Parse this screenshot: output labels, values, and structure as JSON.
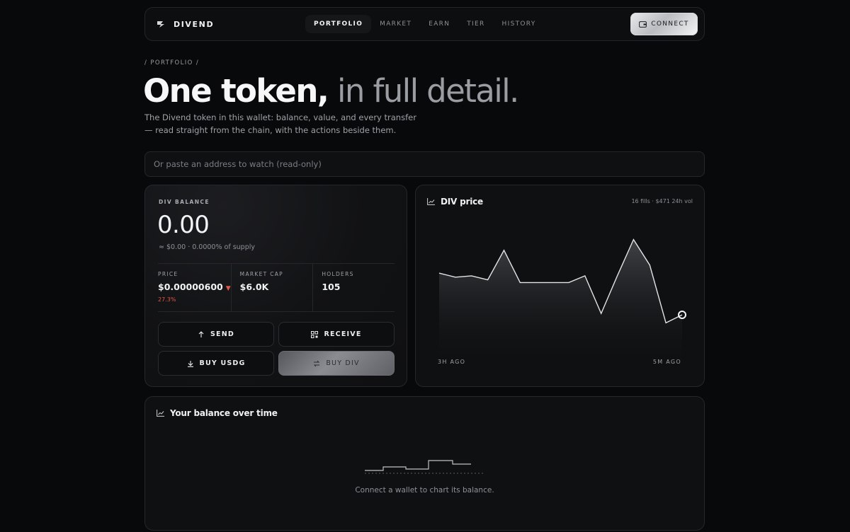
{
  "nav": {
    "brand": "DIVEND",
    "links": [
      "PORTFOLIO",
      "MARKET",
      "EARN",
      "TIER",
      "HISTORY"
    ],
    "active": "PORTFOLIO",
    "connect_label": "CONNECT"
  },
  "hero": {
    "breadcrumb": "/ PORTFOLIO /",
    "title_strong": "One token,",
    "title_light": " in full detail.",
    "description": "The Divend token in this wallet: balance, value, and every transfer — read straight from the chain, with the actions beside them."
  },
  "address": {
    "placeholder": "Or paste an address to watch (read-only)",
    "value": ""
  },
  "balance": {
    "label": "DIV BALANCE",
    "value": "0.00",
    "sub": "≈ $0.00 · 0.0000% of supply",
    "stats": {
      "price_label": "PRICE",
      "price_value": "$0.00000600",
      "price_change": "27.3%",
      "price_direction": "down",
      "cap_label": "MARKET CAP",
      "cap_value": "$6.0K",
      "holders_label": "HOLDERS",
      "holders_value": "105"
    },
    "actions": {
      "send": "SEND",
      "receive": "RECEIVE",
      "buy_usdg": "BUY USDG",
      "buy_div": "BUY DIV"
    }
  },
  "price_chart": {
    "title": "DIV price",
    "meta": "16 fills · $471 24h vol",
    "x_start_label": "3H AGO",
    "x_end_label": "5M AGO"
  },
  "history": {
    "title": "Your balance over time",
    "empty_message": "Connect a wallet to chart its balance."
  },
  "colors": {
    "background": "#08090a",
    "card": "#0f1012",
    "border": "#25272b",
    "negative": "#e0574a"
  },
  "chart_data": {
    "type": "line",
    "title": "DIV price",
    "x": [
      "3H AGO",
      "",
      "",
      "",
      "",
      "",
      "",
      "",
      "",
      "",
      "",
      "",
      "",
      "",
      "",
      "5M AGO"
    ],
    "series": [
      {
        "values": [
          6.1,
          5.8,
          5.9,
          5.6,
          7.8,
          5.4,
          5.4,
          5.4,
          5.4,
          5.9,
          3.1,
          5.9,
          8.6,
          6.7,
          2.4,
          3.0
        ]
      }
    ],
    "ylim": [
      0,
      10
    ],
    "grid": false,
    "legend": "none"
  }
}
